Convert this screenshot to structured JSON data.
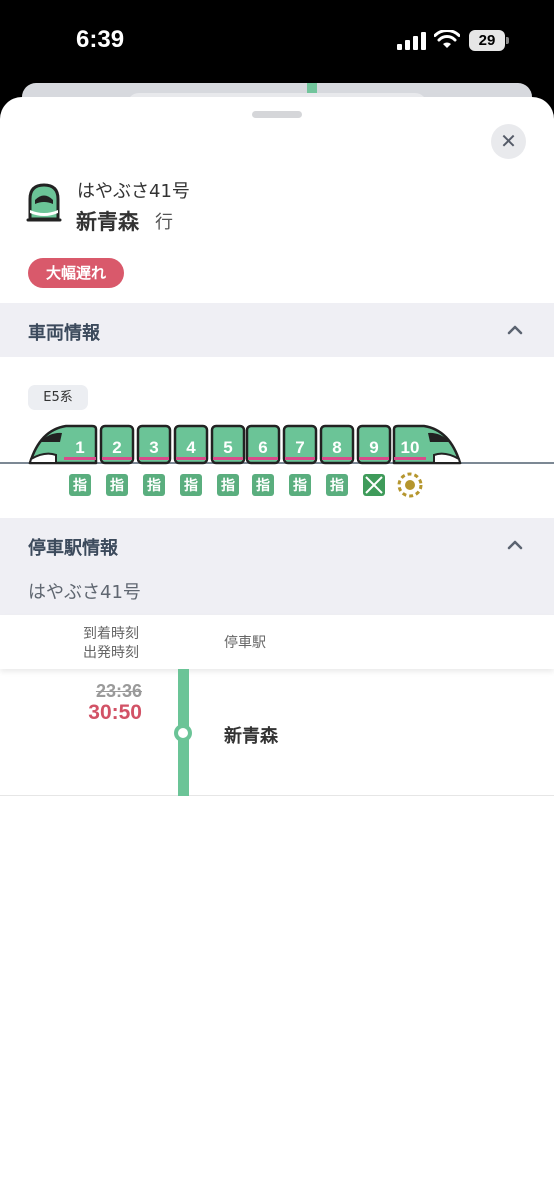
{
  "status_bar": {
    "time": "6:39",
    "battery": "29"
  },
  "train": {
    "name": "はやぶさ41号",
    "destination": "新青森",
    "destination_suffix": "行",
    "delay_badge": "大幅遅れ"
  },
  "vehicle_section": {
    "title": "車両情報",
    "series": "E5系",
    "cars": [
      {
        "number": "1",
        "seat": "指"
      },
      {
        "number": "2",
        "seat": "指"
      },
      {
        "number": "3",
        "seat": "指"
      },
      {
        "number": "4",
        "seat": "指"
      },
      {
        "number": "5",
        "seat": "指"
      },
      {
        "number": "6",
        "seat": "指"
      },
      {
        "number": "7",
        "seat": "指"
      },
      {
        "number": "8",
        "seat": "指"
      },
      {
        "number": "9",
        "seat": "green-car-icon"
      },
      {
        "number": "10",
        "seat": "gran-class-icon"
      }
    ]
  },
  "stops_section": {
    "title": "停車駅情報",
    "train_name": "はやぶさ41号",
    "col_time_line1": "到着時刻",
    "col_time_line2": "出発時刻",
    "col_station": "停車駅",
    "stops": [
      {
        "scheduled": "23:36",
        "actual": "30:50",
        "station": "新青森"
      }
    ]
  },
  "colors": {
    "accent_green": "#6bc497",
    "delay_red": "#d9596b",
    "header_bg": "#efeff4",
    "car_pink": "#d94b8a"
  }
}
